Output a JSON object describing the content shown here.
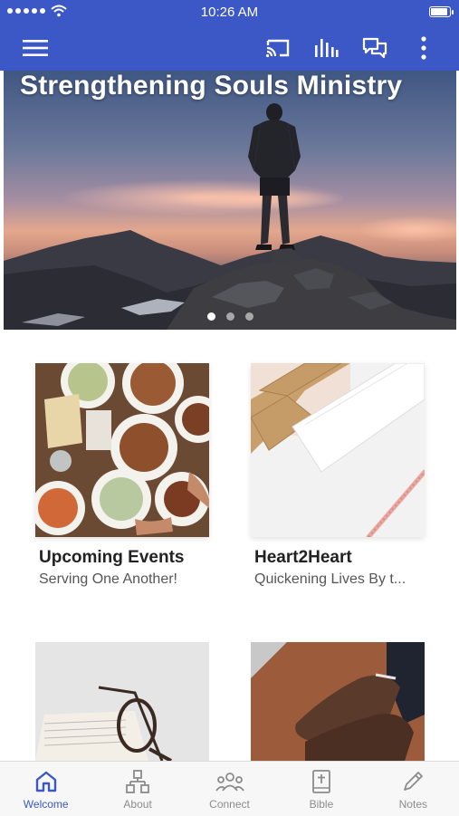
{
  "status_bar": {
    "time": "10:26 AM"
  },
  "app_bar": {
    "icons": [
      "menu-icon",
      "cast-icon",
      "audio-bars-icon",
      "chat-icon",
      "more-vert-icon"
    ],
    "color": "#3b58c6"
  },
  "hero": {
    "title": "Strengthening Souls Ministry",
    "slides": 3,
    "active_slide": 1
  },
  "cards": [
    {
      "title": "Upcoming Events",
      "subtitle": "Serving One Another!"
    },
    {
      "title": "Heart2Heart",
      "subtitle": "Quickening Lives By t..."
    },
    {
      "title": "",
      "subtitle": ""
    },
    {
      "title": "",
      "subtitle": ""
    }
  ],
  "bottom_nav": {
    "items": [
      {
        "label": "Welcome",
        "icon": "home-icon",
        "active": true
      },
      {
        "label": "About",
        "icon": "org-chart-icon",
        "active": false
      },
      {
        "label": "Connect",
        "icon": "people-icon",
        "active": false
      },
      {
        "label": "Bible",
        "icon": "bible-icon",
        "active": false
      },
      {
        "label": "Notes",
        "icon": "pencil-icon",
        "active": false
      }
    ],
    "active_color": "#3b58c6",
    "inactive_color": "#8b8b8b"
  }
}
